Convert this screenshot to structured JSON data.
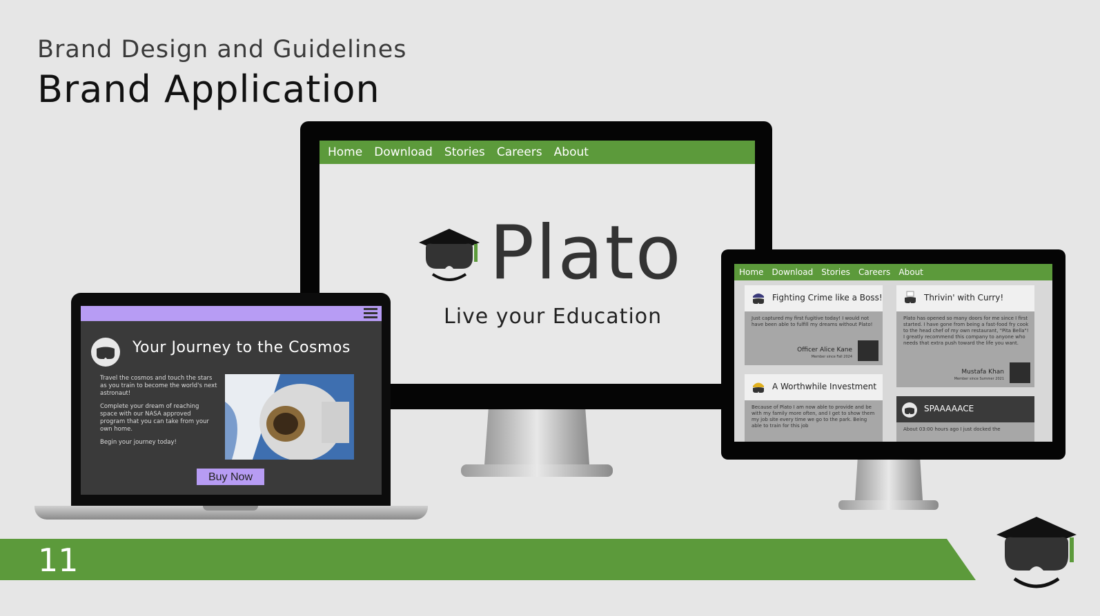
{
  "slide": {
    "subtitle": "Brand Design and Guidelines",
    "title": "Brand Application",
    "page_number": "11"
  },
  "colors": {
    "brand_green": "#5c9a3b",
    "accent_purple": "#b79cf4",
    "dark_gray": "#3a3a3a",
    "background": "#e6e6e6"
  },
  "desktop": {
    "nav": [
      "Home",
      "Download",
      "Stories",
      "Careers",
      "About"
    ],
    "brand_name": "Plato",
    "tagline": "Live your Education"
  },
  "laptop": {
    "heading": "Your Journey to the Cosmos",
    "paragraphs": [
      "Travel the cosmos and touch the stars as you train to become the world's next astronaut!",
      "Complete your dream of reaching space with our NASA approved program that you can take from your own home.",
      "Begin your journey today!"
    ],
    "button": "Buy Now",
    "menu_icon": "hamburger-menu-icon",
    "photo": "astronaut-photo"
  },
  "tablet": {
    "nav": [
      "Home",
      "Download",
      "Stories",
      "Careers",
      "About"
    ],
    "cards": [
      {
        "title": "Fighting Crime like a Boss!",
        "text": "Just captured my first fugitive today! I would not have been able to fulfill my dreams without Plato!",
        "author": "Officer Alice Kane",
        "since": "Member since Fall 2024"
      },
      {
        "title": "Thrivin' with Curry!",
        "text": "Plato has opened so many doors for me since I first started. I have gone from being a fast-food fry cook to the head chef of my own restaurant, \"Pita Bella\"! I greatly recommend this company to anyone who needs that extra push toward the life you want.",
        "author": "Mustafa Khan",
        "since": "Member since Summer 2021"
      },
      {
        "title": "A Worthwhile Investment",
        "text": "Because of Plato I am now able to provide and be with my family more often, and I get to show them my job site every time we go to the park. Being able to train for this job"
      },
      {
        "title": "SPAAAAACE",
        "text": "About 03:00 hours ago I just docked the"
      }
    ]
  }
}
